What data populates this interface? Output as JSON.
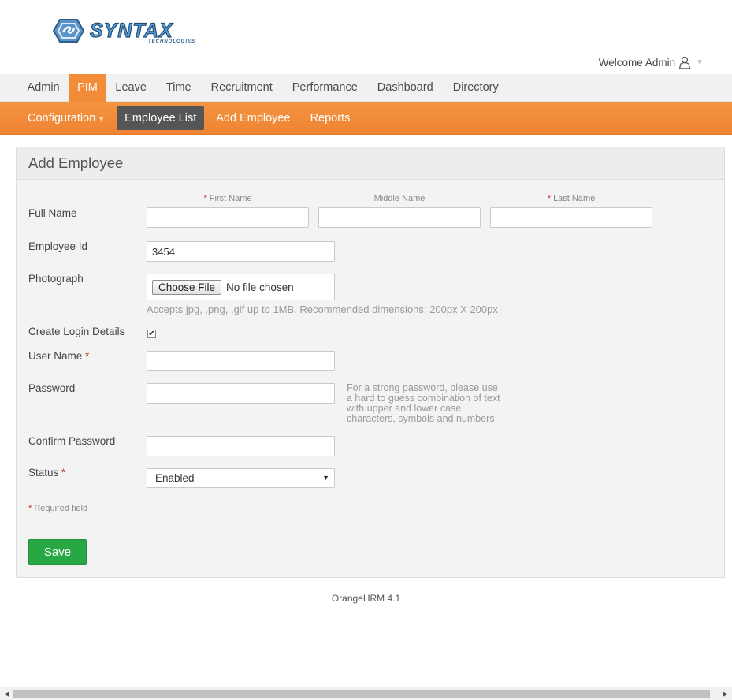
{
  "header": {
    "logo_text": "SYNTAX",
    "logo_subtext": "TECHNOLOGIES",
    "welcome": "Welcome Admin"
  },
  "main_menu": {
    "items": [
      {
        "label": "Admin"
      },
      {
        "label": "PIM",
        "active": true
      },
      {
        "label": "Leave"
      },
      {
        "label": "Time"
      },
      {
        "label": "Recruitment"
      },
      {
        "label": "Performance"
      },
      {
        "label": "Dashboard"
      },
      {
        "label": "Directory"
      }
    ]
  },
  "sub_menu": {
    "items": [
      {
        "label": "Configuration",
        "has_dropdown": true
      },
      {
        "label": "Employee List",
        "active": true
      },
      {
        "label": "Add Employee"
      },
      {
        "label": "Reports"
      }
    ]
  },
  "form": {
    "title": "Add Employee",
    "full_name_label": "Full Name",
    "first_name_label": "First Name",
    "middle_name_label": "Middle Name",
    "last_name_label": "Last Name",
    "first_name_value": "",
    "middle_name_value": "",
    "last_name_value": "",
    "employee_id_label": "Employee Id",
    "employee_id_value": "3454",
    "photograph_label": "Photograph",
    "choose_file_label": "Choose File",
    "no_file_text": "No file chosen",
    "photo_hint": "Accepts jpg, .png, .gif up to 1MB. Recommended dimensions: 200px X 200px",
    "create_login_label": "Create Login Details",
    "create_login_checked": true,
    "username_label": "User Name",
    "username_value": "",
    "password_label": "Password",
    "password_value": "",
    "password_hint": "For a strong password, please use a hard to guess combination of text with upper and lower case characters, symbols and numbers",
    "confirm_password_label": "Confirm Password",
    "confirm_password_value": "",
    "status_label": "Status",
    "status_value": "Enabled",
    "required_star": "*",
    "required_note": "Required field",
    "save_label": "Save"
  },
  "footer": {
    "text": "OrangeHRM 4.1"
  },
  "colors": {
    "accent": "#f28c38",
    "save": "#28a745",
    "required": "#c0392b"
  }
}
